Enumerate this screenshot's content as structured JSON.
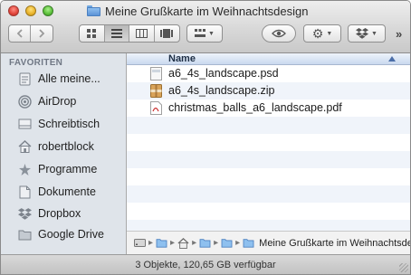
{
  "window": {
    "title": "Meine Grußkarte im Weihnachtsdesign"
  },
  "toolbar": {
    "back_icon": "chevron-left-icon",
    "forward_icon": "chevron-right-icon",
    "views": [
      "icon-view",
      "list-view",
      "column-view",
      "coverflow-view"
    ],
    "active_view": "list-view",
    "overflow_label": "»"
  },
  "sidebar": {
    "header": "FAVORITEN",
    "items": [
      {
        "label": "Alle meine...",
        "icon": "all-files-icon"
      },
      {
        "label": "AirDrop",
        "icon": "airdrop-icon"
      },
      {
        "label": "Schreibtisch",
        "icon": "desktop-icon"
      },
      {
        "label": "robertblock",
        "icon": "home-icon"
      },
      {
        "label": "Programme",
        "icon": "applications-icon"
      },
      {
        "label": "Dokumente",
        "icon": "documents-icon"
      },
      {
        "label": "Dropbox",
        "icon": "dropbox-icon"
      },
      {
        "label": "Google Drive",
        "icon": "folder-icon"
      }
    ]
  },
  "list": {
    "column_name": "Name",
    "files": [
      {
        "name": "a6_4s_landscape.psd",
        "icon": "psd-file-icon"
      },
      {
        "name": "a6_4s_landscape.zip",
        "icon": "zip-file-icon"
      },
      {
        "name": "christmas_balls_a6_landscape.pdf",
        "icon": "pdf-file-icon"
      }
    ]
  },
  "pathbar": {
    "current": "Meine Grußkarte im Weihnachtsdesign"
  },
  "status": {
    "text": "3 Objekte, 120,65 GB verfügbar"
  },
  "colors": {
    "sidebar_bg": "#dfe4ea",
    "folder_blue": "#5b93d6",
    "header_blue": "#c9d9ef"
  }
}
